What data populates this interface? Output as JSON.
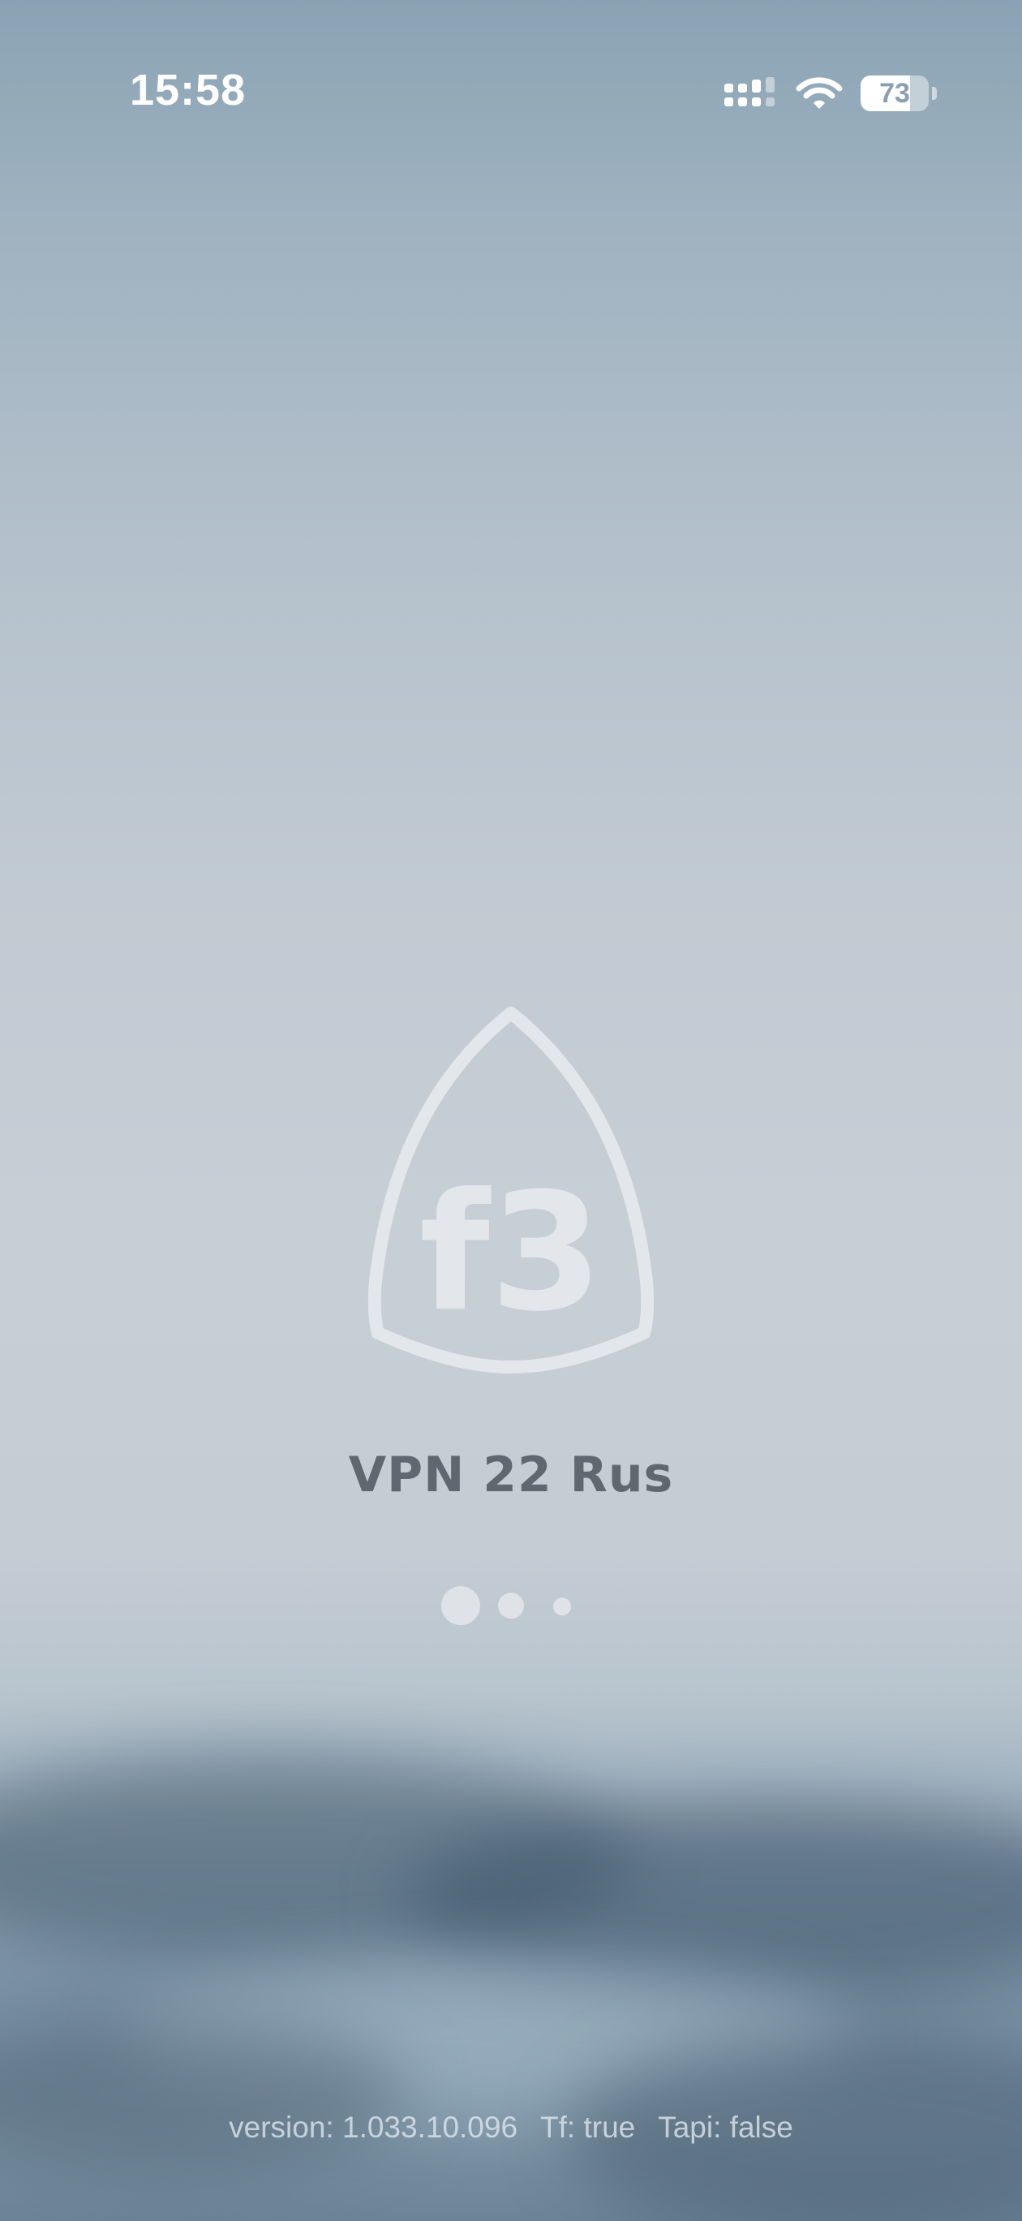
{
  "status_bar": {
    "time": "15:58",
    "battery_level": "73",
    "icons": [
      "cellular-signal-icon",
      "wifi-icon",
      "battery-icon"
    ]
  },
  "splash": {
    "logo_text": "f3",
    "app_name": "VPN 22 Rus",
    "loading_dots": 3
  },
  "footer": {
    "version": "version: 1.033.10.096",
    "tf": "Tf: true",
    "tapi": "Tapi: false"
  },
  "colors": {
    "logo": "#e3e6ea",
    "app_name": "#5f6770",
    "footer_text": "#e1e8ee"
  }
}
